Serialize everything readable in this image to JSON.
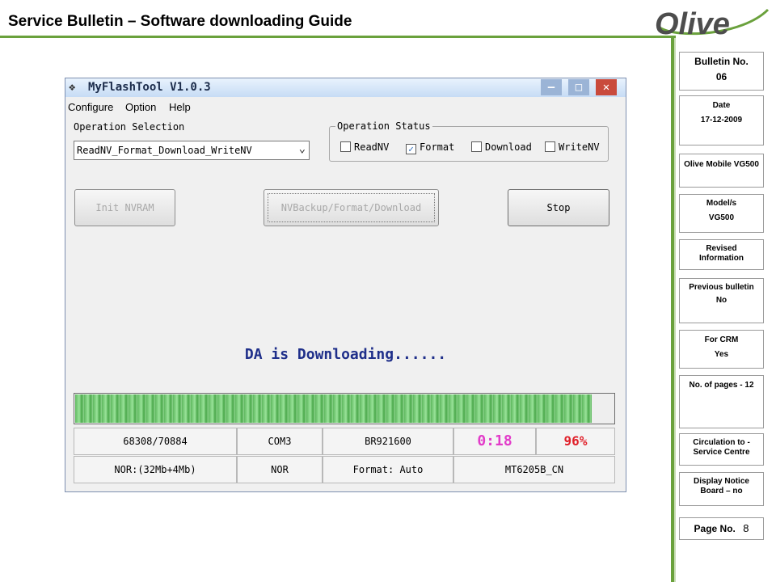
{
  "page": {
    "title": "Service Bulletin – Software downloading Guide",
    "logo_text": "Olive",
    "colors": {
      "accent_green": "#6aa13c",
      "logo_gray": "#4d4d4d"
    }
  },
  "sidebar": {
    "bulletin_label": "Bulletin No.",
    "bulletin_value": "06",
    "date_label": "Date",
    "date_value": "17-12-2009",
    "product": "Olive Mobile VG500",
    "model_label": "Model/s",
    "model_value": "VG500",
    "revised": "Revised Information",
    "previous_label": "Previous bulletin",
    "previous_value": "No",
    "crm_label": "For CRM",
    "crm_value": "Yes",
    "pages": "No. of pages - 12",
    "circulation": "Circulation to - Service Centre",
    "display": "Display Notice Board – no",
    "page_label": "Page No.",
    "page_value": "8"
  },
  "app": {
    "title": "MyFlashTool V1.0.3",
    "window_buttons": {
      "min": "—",
      "max": "□",
      "close": "✕"
    },
    "menu": [
      "Configure",
      "Option",
      "Help"
    ],
    "operation_selection_label": "Operation Selection",
    "operation_selection_value": "ReadNV_Format_Download_WriteNV",
    "operation_status_label": "Operation Status",
    "checkboxes": [
      {
        "label": "ReadNV",
        "checked": false
      },
      {
        "label": "Format",
        "checked": true
      },
      {
        "label": "Download",
        "checked": false
      },
      {
        "label": "WriteNV",
        "checked": false
      }
    ],
    "buttons": {
      "init": "Init NVRAM",
      "nvbackup": "NVBackup/Format/Download",
      "stop": "Stop"
    },
    "message": "DA is Downloading......",
    "progress": 0.96,
    "status_row1": [
      "68308/70884",
      "COM3",
      "BR921600",
      "0:18",
      "96%"
    ],
    "status_row2": [
      "NOR:(32Mb+4Mb)",
      "NOR",
      "Format: Auto",
      "MT6205B_CN"
    ]
  }
}
